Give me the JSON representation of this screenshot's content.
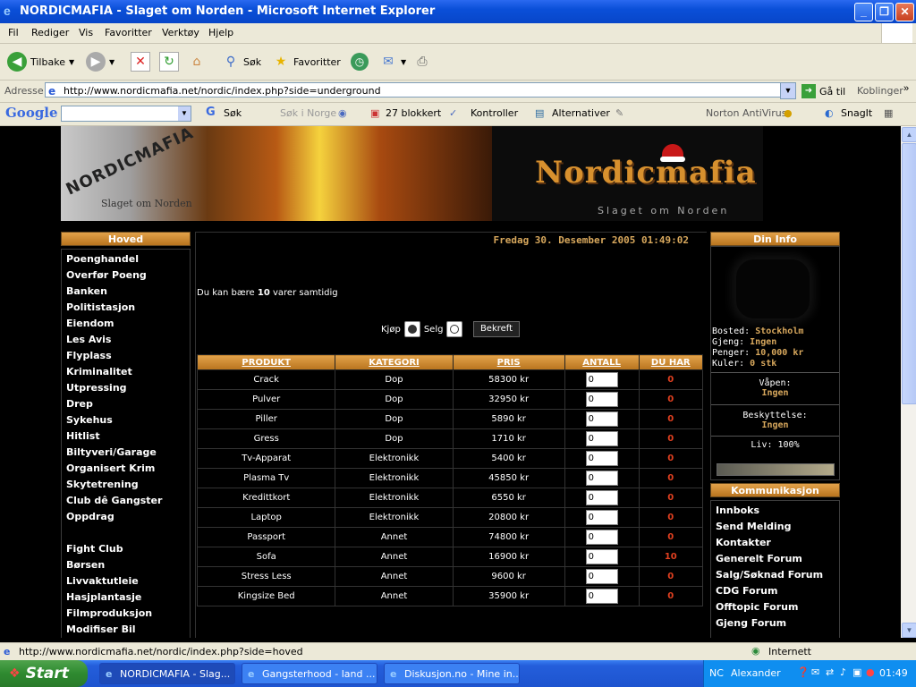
{
  "window": {
    "title": "NORDICMAFIA - Slaget om Norden - Microsoft Internet Explorer",
    "minimize": "_",
    "maximize": "❐",
    "close": "✕"
  },
  "menu": [
    "Fil",
    "Rediger",
    "Vis",
    "Favoritter",
    "Verktøy",
    "Hjelp"
  ],
  "toolbar": {
    "back": "Tilbake",
    "search": "Søk",
    "favorites": "Favoritter"
  },
  "address": {
    "label": "Adresse",
    "url": "http://www.nordicmafia.net/nordic/index.php?side=underground",
    "go": "Gå til",
    "links": "Koblinger"
  },
  "googlebar": {
    "brand": "Google",
    "search": "Søk",
    "search_norway": "Søk i Norge",
    "blocked": "27 blokkert",
    "check": "Kontroller",
    "options": "Alternativer",
    "antivirus": "Norton AntiVirus",
    "snagit": "SnagIt"
  },
  "banner": {
    "logo_text": "NORDICMAFIA",
    "logo_sub": "Slaget om Norden",
    "brand": "Nordicmafia",
    "brand_sub": "Slaget om Norden"
  },
  "left_menu": {
    "title": "Hoved",
    "items": [
      "Poenghandel",
      "Overfør Poeng",
      "Banken",
      "Politistasjon",
      "Eiendom",
      "Les Avis",
      "Flyplass",
      "Kriminalitet",
      "Utpressing",
      "Drep",
      "Sykehus",
      "Hitlist",
      "Biltyveri/Garage",
      "Organisert Krim",
      "Skytetrening",
      "Club dê Gangster",
      "Oppdrag"
    ],
    "items2": [
      "Fight Club",
      "Børsen",
      "Livvaktutleie",
      "Hasjplantasje",
      "Filmproduksjon",
      "Modifiser Bil"
    ]
  },
  "center": {
    "datetime": "Fredag 30. Desember 2005 01:49:02",
    "capacity_prefix": "Du kan bære",
    "capacity_value": "10",
    "capacity_suffix": "varer samtidig",
    "buy": "Kjøp",
    "sell": "Selg",
    "confirm": "Bekreft",
    "buy_selected": true,
    "columns": [
      "PRODUKT",
      "KATEGORI",
      "PRIS",
      "ANTALL",
      "DU HAR"
    ],
    "rows": [
      {
        "product": "Crack",
        "category": "Dop",
        "price": "58300 kr",
        "qty": "0",
        "owned": "0"
      },
      {
        "product": "Pulver",
        "category": "Dop",
        "price": "32950 kr",
        "qty": "0",
        "owned": "0"
      },
      {
        "product": "Piller",
        "category": "Dop",
        "price": "5890 kr",
        "qty": "0",
        "owned": "0"
      },
      {
        "product": "Gress",
        "category": "Dop",
        "price": "1710 kr",
        "qty": "0",
        "owned": "0"
      },
      {
        "product": "Tv-Apparat",
        "category": "Elektronikk",
        "price": "5400 kr",
        "qty": "0",
        "owned": "0"
      },
      {
        "product": "Plasma Tv",
        "category": "Elektronikk",
        "price": "45850 kr",
        "qty": "0",
        "owned": "0"
      },
      {
        "product": "Kredittkort",
        "category": "Elektronikk",
        "price": "6550 kr",
        "qty": "0",
        "owned": "0"
      },
      {
        "product": "Laptop",
        "category": "Elektronikk",
        "price": "20800 kr",
        "qty": "0",
        "owned": "0"
      },
      {
        "product": "Passport",
        "category": "Annet",
        "price": "74800 kr",
        "qty": "0",
        "owned": "0"
      },
      {
        "product": "Sofa",
        "category": "Annet",
        "price": "16900 kr",
        "qty": "0",
        "owned": "10"
      },
      {
        "product": "Stress Less",
        "category": "Annet",
        "price": "9600 kr",
        "qty": "0",
        "owned": "0"
      },
      {
        "product": "Kingsize Bed",
        "category": "Annet",
        "price": "35900 kr",
        "qty": "0",
        "owned": "0"
      }
    ]
  },
  "info": {
    "title": "Din Info",
    "residence_label": "Bosted:",
    "residence": "Stockholm",
    "gang_label": "Gjeng:",
    "gang": "Ingen",
    "money_label": "Penger:",
    "money": "10,000 kr",
    "bullets_label": "Kuler:",
    "bullets": "0 stk",
    "weapon_label": "Våpen:",
    "weapon": "Ingen",
    "protection_label": "Beskyttelse:",
    "protection": "Ingen",
    "life": "Liv: 100%",
    "life_fraction": 1.0
  },
  "communication": {
    "title": "Kommunikasjon",
    "items": [
      "Innboks",
      "Send Melding",
      "Kontakter",
      "Generelt Forum",
      "Salg/Søknad Forum",
      "CDG Forum",
      "Offtopic Forum",
      "Gjeng Forum"
    ]
  },
  "status": {
    "url": "http://www.nordicmafia.net/nordic/index.php?side=hoved",
    "zone": "Internett"
  },
  "taskbar": {
    "start": "Start",
    "items": [
      "NORDICMAFIA - Slag...",
      "Gangsterhood - land ...",
      "Diskusjon.no - Mine in..."
    ],
    "lang": "NC",
    "user": "Alexander",
    "clock": "01:49"
  }
}
